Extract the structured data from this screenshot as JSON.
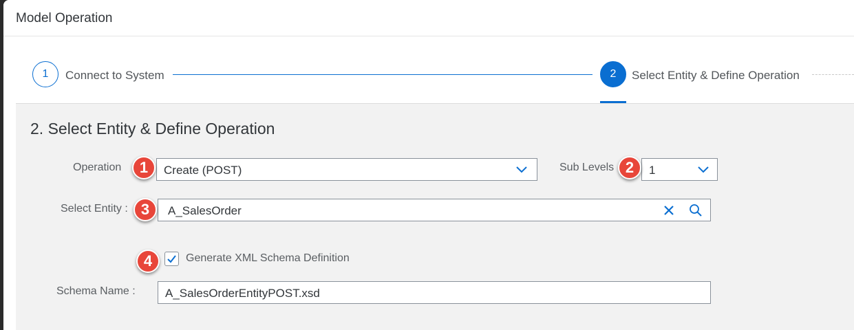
{
  "dialog": {
    "title": "Model Operation"
  },
  "wizard": {
    "steps": [
      {
        "number": "1",
        "label": "Connect to System",
        "state": "completed"
      },
      {
        "number": "2",
        "label": "Select Entity & Define Operation",
        "state": "active"
      }
    ]
  },
  "section": {
    "title": "2. Select Entity & Define Operation"
  },
  "form": {
    "operation": {
      "label": "Operation",
      "value": "Create (POST)"
    },
    "sub_levels": {
      "label": "Sub Levels",
      "value": "1"
    },
    "select_entity": {
      "label": "Select Entity :",
      "value": "A_SalesOrder"
    },
    "generate_xsd": {
      "label": "Generate XML Schema Definition",
      "checked": true
    },
    "schema_name": {
      "label": "Schema Name :",
      "value": "A_SalesOrderEntityPOST.xsd"
    }
  },
  "annotations": [
    "1",
    "2",
    "3",
    "4"
  ],
  "icons": {
    "dropdown": "chevron-down-icon",
    "clear": "close-icon",
    "search": "search-icon",
    "checkbox": "checkmark-icon"
  },
  "colors": {
    "accent": "#0a6ed1",
    "badge": "#e8463a",
    "content_background": "#f2f2f2"
  }
}
